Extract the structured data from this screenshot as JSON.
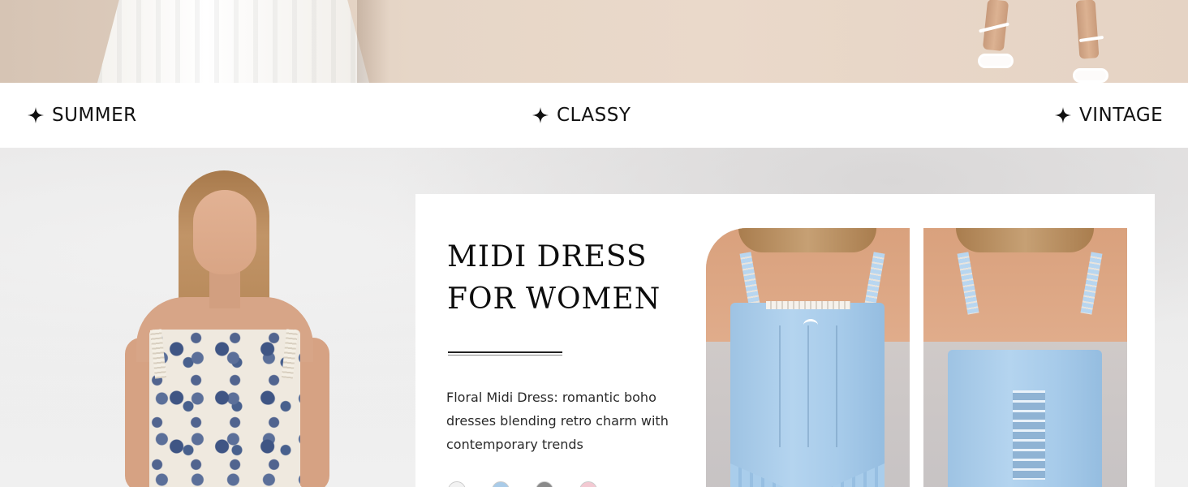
{
  "tags": [
    {
      "label": "SUMMER",
      "icon": "sparkle-icon"
    },
    {
      "label": "CLASSY",
      "icon": "sparkle-icon"
    },
    {
      "label": "VINTAGE",
      "icon": "sparkle-icon"
    }
  ],
  "card": {
    "title_line1": "MIDI DRESS",
    "title_line2": "FOR WOMEN",
    "description": "Floral Midi Dress: romantic boho dresses blending retro charm with contemporary trends",
    "swatches": [
      "#f2f2f2",
      "#a9cbe8",
      "#8a8a8a",
      "#f3c9d2"
    ]
  },
  "colors": {
    "text": "#111111",
    "card_bg": "#ffffff",
    "dress_blue": "#a7cbea"
  }
}
